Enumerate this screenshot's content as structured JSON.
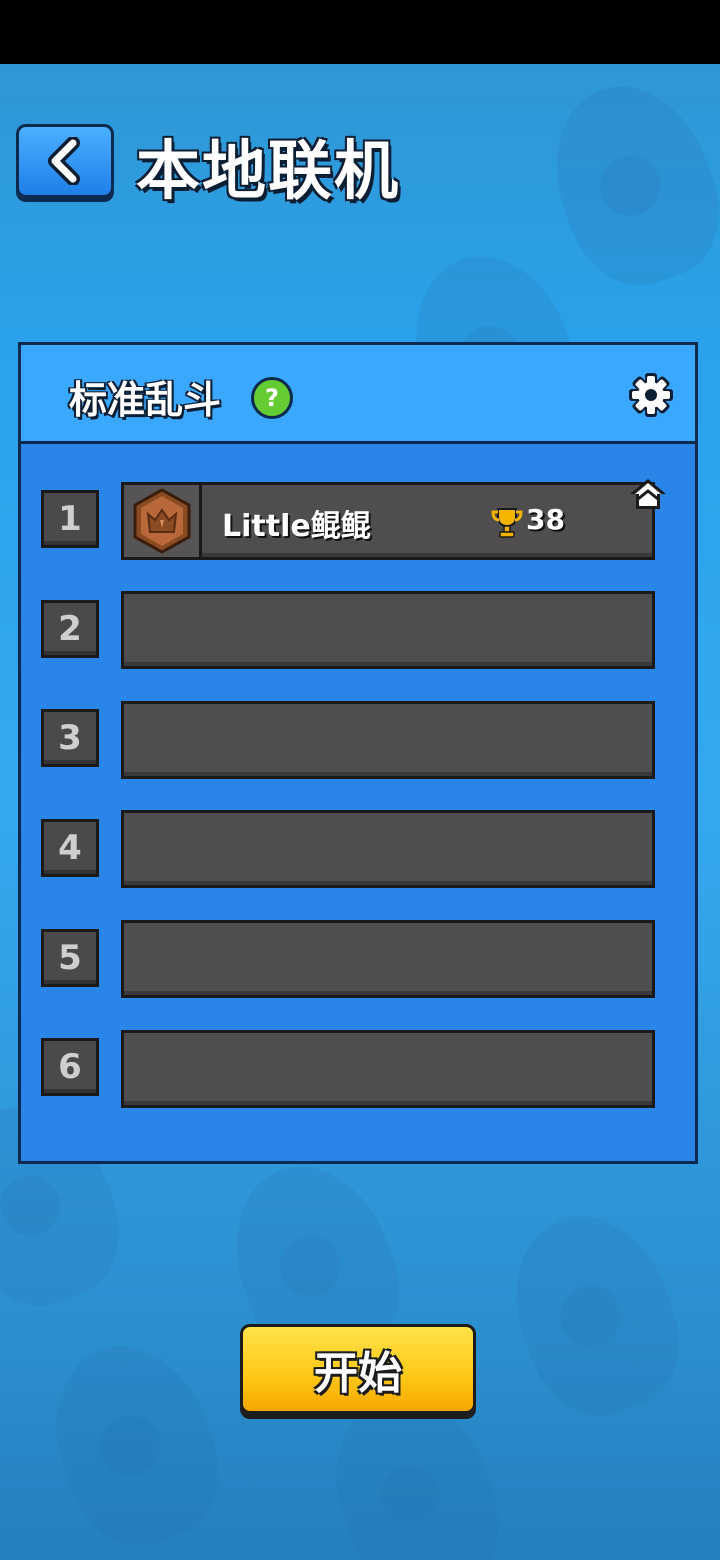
{
  "header": {
    "title": "本地联机",
    "back_icon": "chevron-left-icon"
  },
  "panel": {
    "mode_title": "标准乱斗",
    "help_label": "?",
    "settings_icon": "gear-icon"
  },
  "slots": [
    {
      "number": "1",
      "player": {
        "name": "Little鲲鲲",
        "trophies": "38",
        "is_host": true,
        "badge_icon": "bronze-rank-badge-icon",
        "trophy_icon": "trophy-icon"
      }
    },
    {
      "number": "2"
    },
    {
      "number": "3"
    },
    {
      "number": "4"
    },
    {
      "number": "5"
    },
    {
      "number": "6"
    }
  ],
  "start_button": {
    "label": "开始"
  },
  "colors": {
    "background": "#35a8f0",
    "panel": "#2a85e8",
    "panel_header": "#3aa8ff",
    "slot": "#4f4d4d",
    "start_button": "#ffcb1a",
    "help_button": "#66cc33"
  }
}
